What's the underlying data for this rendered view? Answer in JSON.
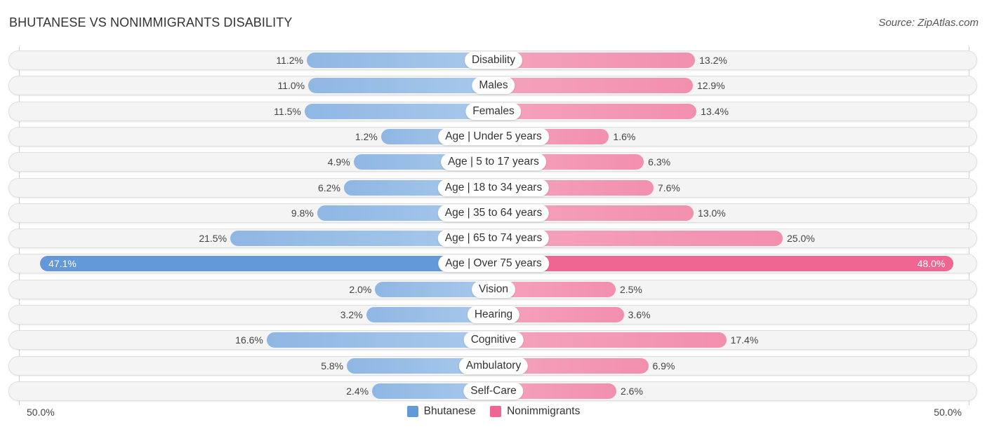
{
  "header": {
    "title": "BHUTANESE VS NONIMMIGRANTS DISABILITY",
    "source": "Source: ZipAtlas.com"
  },
  "colors": {
    "bhutanese": "#6399d9",
    "nonimmigrants": "#f06692"
  },
  "chart_data": {
    "type": "bar",
    "orientation": "horizontal-diverging",
    "title": "BHUTANESE VS NONIMMIGRANTS DISABILITY",
    "categories": [
      "Disability",
      "Males",
      "Females",
      "Age | Under 5 years",
      "Age | 5 to 17 years",
      "Age | 18 to 34 years",
      "Age | 35 to 64 years",
      "Age | 65 to 74 years",
      "Age | Over 75 years",
      "Vision",
      "Hearing",
      "Cognitive",
      "Ambulatory",
      "Self-Care"
    ],
    "series": [
      {
        "name": "Bhutanese",
        "side": "left",
        "values": [
          11.2,
          11.0,
          11.5,
          1.2,
          4.9,
          6.2,
          9.8,
          21.5,
          47.1,
          2.0,
          3.2,
          16.6,
          5.8,
          2.4
        ]
      },
      {
        "name": "Nonimmigrants",
        "side": "right",
        "values": [
          13.2,
          12.9,
          13.4,
          1.6,
          6.3,
          7.6,
          13.0,
          25.0,
          48.0,
          2.5,
          3.6,
          17.4,
          6.9,
          2.6
        ]
      }
    ],
    "value_suffix": "%",
    "xlim": [
      0,
      50
    ],
    "axis_labels": {
      "left": "50.0%",
      "right": "50.0%"
    },
    "legend": {
      "position": "bottom-center",
      "entries": [
        "Bhutanese",
        "Nonimmigrants"
      ]
    }
  }
}
